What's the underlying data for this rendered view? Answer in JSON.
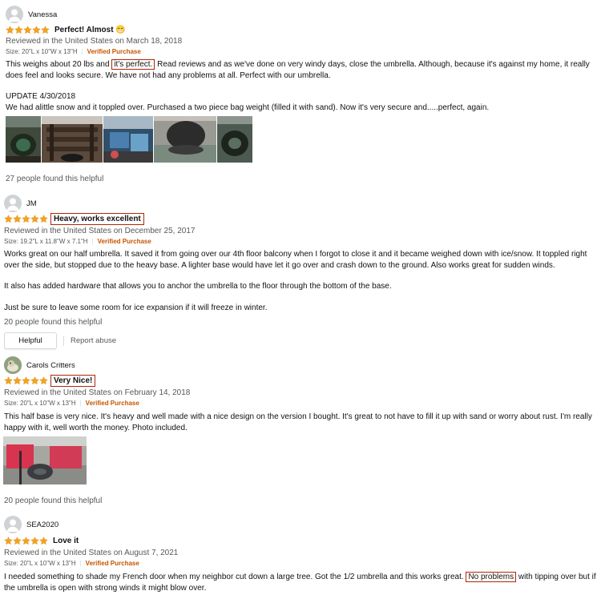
{
  "colors": {
    "star": "#f6a21d",
    "verified": "#c45500",
    "highlight_box": "#b12704",
    "meta_text": "#565959"
  },
  "reviews": [
    {
      "username": "Vanessa",
      "avatar_icon": "default-user-icon",
      "rating": 5,
      "title": "Perfect! Almost 😁",
      "reviewed": "Reviewed in the United States on March 18, 2018",
      "size": "Size: 20\"L x 10\"W x 13\"H",
      "verified": "Verified Purchase",
      "body_1a": "This weighs about 20 lbs and ",
      "body_1_highlight": "it's perfect.",
      "body_1b": " Read reviews and as we've done on very windy days, close the umbrella. Although, because it's against my home, it really does feel and looks secure. We have not had any problems at all. Perfect with our  umbrella.",
      "body_2": "UPDATE 4/30/2018",
      "body_3": "We had alittle snow and it toppled over. Purchased a two piece bag weight (filled it with sand). Now it's very secure and.....perfect, again.",
      "photos": [
        "review-photo-1",
        "review-photo-2",
        "review-photo-3",
        "review-photo-4",
        "review-photo-5"
      ],
      "helpful_text": "27 people found this helpful"
    },
    {
      "username": "JM",
      "avatar_icon": "default-user-icon",
      "rating": 5,
      "title": "Heavy, works excellent",
      "reviewed": "Reviewed in the United States on December 25, 2017",
      "size": "Size: 19.2\"L x 11.8\"W x 7.1\"H",
      "verified": "Verified Purchase",
      "body_1": "Works great on our half umbrella. It saved it from going over our 4th floor balcony when I forgot to close it and it became weighed down with ice/snow. It toppled right over the side, but stopped due to the heavy base. A lighter base would have let it go over and crash down to the ground. Also works great for sudden winds.",
      "body_2": "It also has added hardware that allows you to anchor the umbrella to the floor through the bottom of the base.",
      "body_3": "Just be sure to leave some room for ice expansion if it will freeze in winter.",
      "helpful_text": "20 people found this helpful",
      "helpful_button": "Helpful",
      "report_abuse": "Report abuse"
    },
    {
      "username": "Carols Critters",
      "avatar_icon": "profile-photo-avatar",
      "rating": 5,
      "title": "Very Nice!",
      "reviewed": "Reviewed in the United States on February 14, 2018",
      "size": "Size: 20\"L x 10\"W x 13\"H",
      "verified": "Verified Purchase",
      "body_1": "This half base is very nice. It's heavy and well made with a nice design on the version I bought. It's great to not have to fill it up with sand or worry about rust. I'm really happy with it, well worth the money. Photo included.",
      "photos": [
        "review-photo-patio"
      ],
      "helpful_text": "20 people found this helpful"
    },
    {
      "username": "SEA2020",
      "avatar_icon": "default-user-icon",
      "rating": 5,
      "title": "Love it",
      "reviewed": "Reviewed in the United States on August 7, 2021",
      "size": "Size: 20\"L x 10\"W x 13\"H",
      "verified": "Verified Purchase",
      "body_1a": "I needed something to shade my French door when my neighbor cut down a large tree. Got the 1/2 umbrella and this works great. ",
      "body_1_highlight": "No problems",
      "body_1b": " with tipping over but if the umbrella is open with strong winds it might blow over."
    }
  ]
}
